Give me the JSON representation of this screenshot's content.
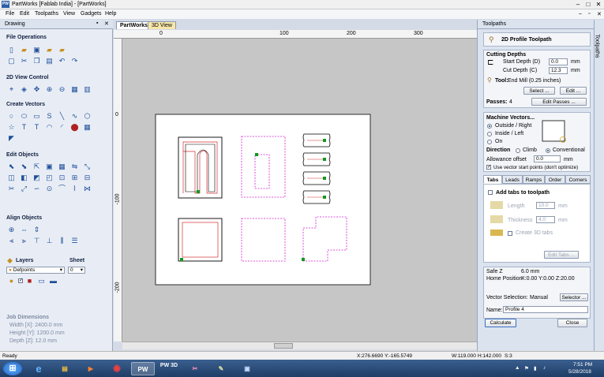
{
  "window": {
    "title": "PartWorks [Fablab India] - [PartWorks]",
    "logo": "PW",
    "controls": [
      "–",
      "□",
      "✕"
    ]
  },
  "menubar": {
    "items": [
      "File",
      "Edit",
      "Toolpaths",
      "View",
      "Gadgets",
      "Help"
    ],
    "child_controls": [
      "–",
      "▫",
      "✕"
    ]
  },
  "left_panel": {
    "tab_label": "Drawing",
    "pin": "▪",
    "close": "✕",
    "sections": [
      "File Operations",
      "2D View Control",
      "Create Vectors",
      "Edit Objects",
      "Align Objects"
    ],
    "layers_label": "Layers",
    "sheet_label": "Sheet",
    "layer_name": "Defpoints",
    "sheet_value": "0",
    "job_dimensions": {
      "title": "Job Dimensions",
      "width": "Width  [X]: 2400.0 mm",
      "height": "Height [Y]: 1200.0 mm",
      "depth": "Depth  [Z]: 12.0 mm"
    }
  },
  "view_tabs": [
    "PartWorks",
    "3D View"
  ],
  "rulers": {
    "top_ticks": [
      "0",
      "100",
      "200",
      "300"
    ],
    "left_ticks": [
      "0",
      "-100",
      "-200"
    ]
  },
  "toolpaths": {
    "panel_title": "Toolpaths",
    "side_tab": "Toolpaths",
    "header": "2D Profile Toolpath",
    "cutting_depths": {
      "title": "Cutting Depths",
      "start_label": "Start Depth (D)",
      "start_value": "0.0",
      "cut_label": "Cut Depth (C)",
      "cut_value": "12.3",
      "unit": "mm"
    },
    "tool": {
      "label": "Tool:",
      "value": "End Mill (0.25 inches)",
      "select_button": "Select ...",
      "edit_button": "Edit ..."
    },
    "passes": {
      "label": "Passes:",
      "value": "4",
      "edit_button": "Edit Passes ..."
    },
    "machine_vectors": {
      "title": "Machine Vectors...",
      "outside": "Outside / Right",
      "inside": "Inside / Left",
      "on": "On"
    },
    "direction": {
      "label": "Direction",
      "climb": "Climb",
      "conventional": "Conventional"
    },
    "allowance": {
      "label": "Allowance offset",
      "value": "0.0",
      "unit": "mm"
    },
    "use_start_points": "Use vector start points (don't optimize)",
    "subtabs": [
      "Tabs",
      "Leads",
      "Ramps",
      "Order",
      "Corners"
    ],
    "tabs_section": {
      "add_tabs": "Add tabs to toolpath",
      "length_label": "Length",
      "length_value": "10.0",
      "thickness_label": "Thickness",
      "thickness_value": "4.0",
      "unit": "mm",
      "create_3d": "Create 3D tabs",
      "edit_tabs": "Edit Tabs ..."
    },
    "safe_z_label": "Safe Z",
    "safe_z_value": "6.0 mm",
    "home_label": "Home Position",
    "home_value": "X:0.00 Y:0.00 Z:20.00",
    "vector_selection_label": "Vector Selection:",
    "vector_selection_value": "Manual",
    "selector_button": "Selector ...",
    "name_label": "Name:",
    "name_value": "Profile 4",
    "calculate_button": "Calculate",
    "close_button": "Close"
  },
  "statusbar": {
    "ready": "Ready",
    "coords": "X:276.6690 Y:-165.5749",
    "width": "W:119.000",
    "height": "H:142.000",
    "sheet": "S:3"
  },
  "taskbar": {
    "apps": [
      "⊞",
      "e",
      "▤",
      "▶",
      "◉",
      "PW",
      "PW 3D",
      "✂",
      "✎",
      "▣"
    ],
    "time": "7:51 PM",
    "date": "5/28/2018"
  },
  "colors": {
    "panel": "#e8edf5",
    "canvas": "#c6c6c6",
    "vector_selected": "#000000",
    "vector_unselected": "#d020d0",
    "start_point": "#0f9a20",
    "toolpath": "#d33030"
  }
}
